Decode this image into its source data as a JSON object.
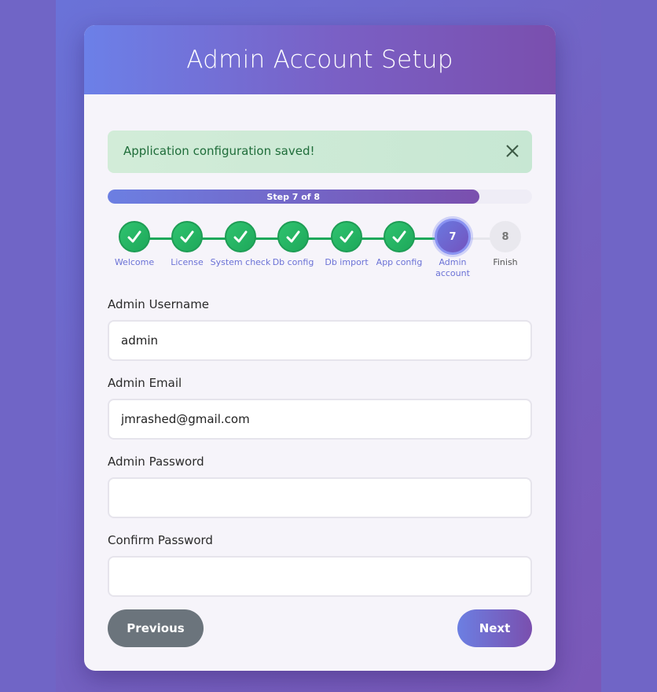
{
  "header": {
    "title": "Admin Account Setup"
  },
  "alert": {
    "message": "Application configuration saved!",
    "close_icon": "close-icon"
  },
  "progress": {
    "text": "Step 7 of 8",
    "current": 7,
    "total": 8
  },
  "steps": [
    {
      "label": "Welcome",
      "state": "done"
    },
    {
      "label": "License",
      "state": "done"
    },
    {
      "label": "System check",
      "state": "done"
    },
    {
      "label": "Db config",
      "state": "done"
    },
    {
      "label": "Db import",
      "state": "done"
    },
    {
      "label": "App config",
      "state": "done"
    },
    {
      "label": "Admin account",
      "number": "7",
      "state": "active"
    },
    {
      "label": "Finish",
      "number": "8",
      "state": "pending"
    }
  ],
  "form": {
    "username": {
      "label": "Admin Username",
      "value": "admin"
    },
    "email": {
      "label": "Admin Email",
      "value": "jmrashed@gmail.com"
    },
    "password": {
      "label": "Admin Password",
      "value": ""
    },
    "confirm": {
      "label": "Confirm Password",
      "value": ""
    }
  },
  "buttons": {
    "previous": "Previous",
    "next": "Next"
  },
  "colors": {
    "accent": "#6c7fe2",
    "accent_dark": "#7a4fae",
    "success": "#1ea85a",
    "alert_bg": "#d2ecd8"
  }
}
